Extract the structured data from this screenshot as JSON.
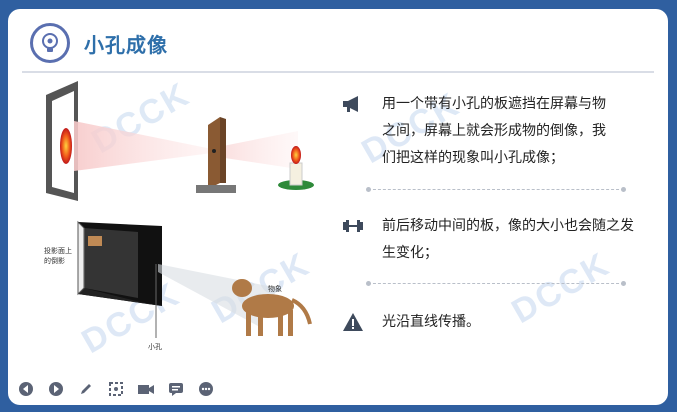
{
  "title": "小孔成像",
  "watermark": "DCCK",
  "diagram_labels": {
    "screen_label_1": "投影面上",
    "screen_label_2": "的倒影",
    "object_label": "物象",
    "hole_label": "小孔"
  },
  "points": [
    {
      "icon": "megaphone-icon",
      "lines": [
        "用一个带有小孔的板遮挡在屏幕与物",
        "之间，屏幕上就会形成物的倒像，我",
        "们把这样的现象叫小孔成像；"
      ]
    },
    {
      "icon": "dumbbell-icon",
      "lines": [
        "前后移动中间的板，像的大小也会随之发",
        "生变化；"
      ]
    },
    {
      "icon": "warning-icon",
      "lines": [
        "光沿直线传播。"
      ]
    }
  ],
  "toolbar": [
    "prev-icon",
    "next-icon",
    "pen-icon",
    "screenshot-icon",
    "camera-icon",
    "comment-icon",
    "more-icon"
  ],
  "colors": {
    "frame": "#2f5fa0",
    "title": "#2e6faa",
    "icon_dark": "#3e4a5c"
  }
}
